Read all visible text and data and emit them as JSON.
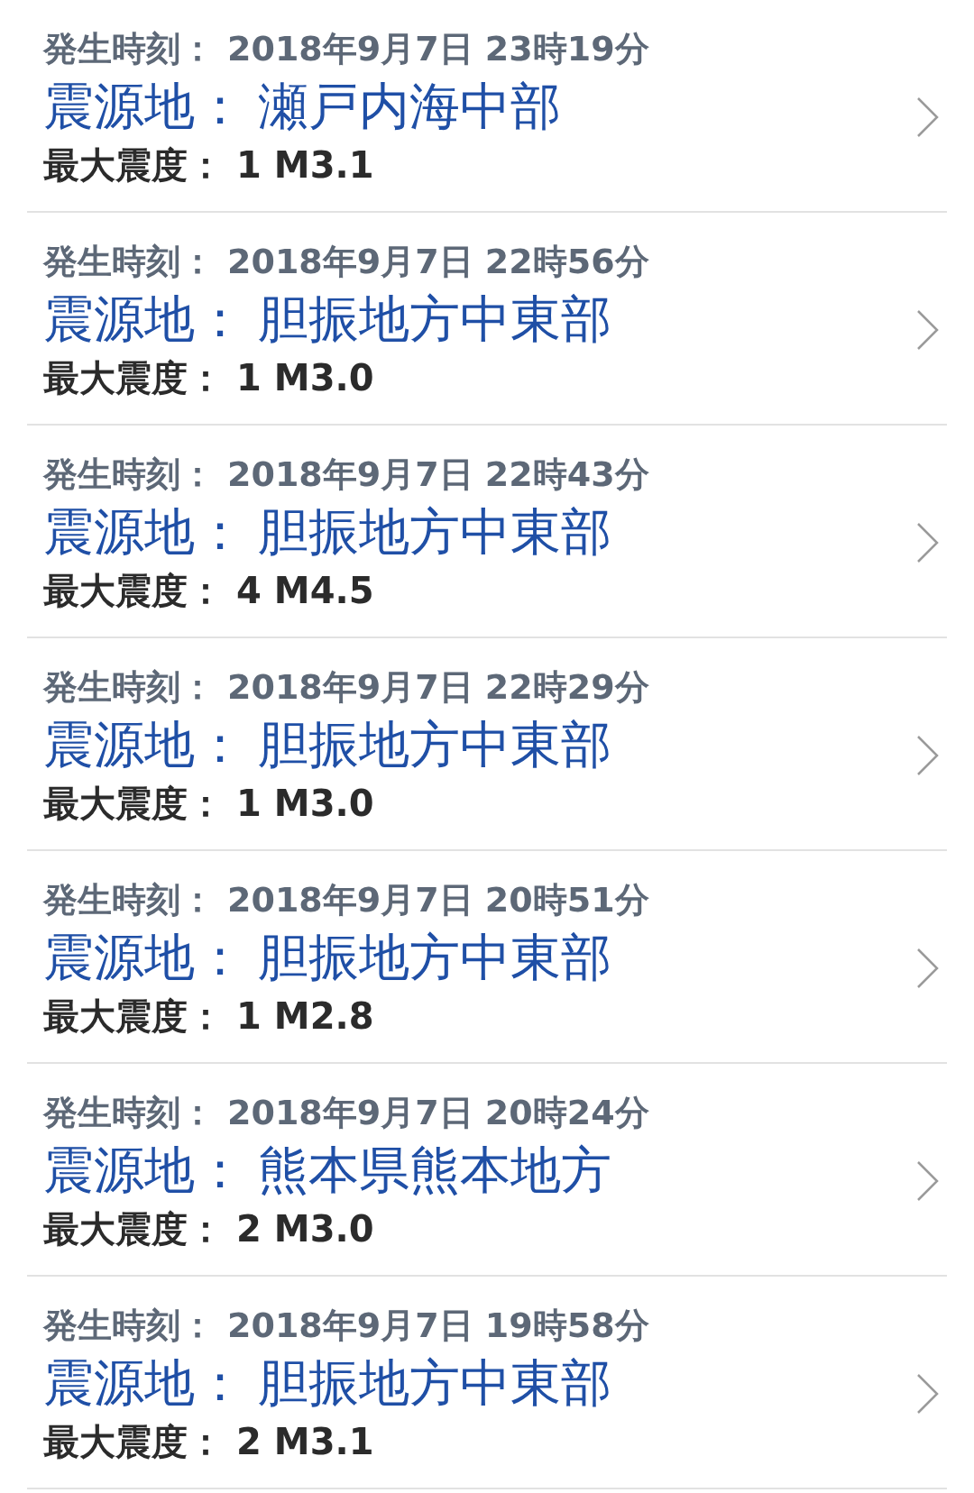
{
  "earthquakes": [
    {
      "time_label": "発生時刻：",
      "time": "2018年9月7日 23時19分",
      "epicenter_label": "震源地：",
      "epicenter": "瀬戸内海中部",
      "intensity_label": "最大震度：",
      "intensity": "1",
      "magnitude": "M3.1"
    },
    {
      "time_label": "発生時刻：",
      "time": "2018年9月7日 22時56分",
      "epicenter_label": "震源地：",
      "epicenter": "胆振地方中東部",
      "intensity_label": "最大震度：",
      "intensity": "1",
      "magnitude": "M3.0"
    },
    {
      "time_label": "発生時刻：",
      "time": "2018年9月7日 22時43分",
      "epicenter_label": "震源地：",
      "epicenter": "胆振地方中東部",
      "intensity_label": "最大震度：",
      "intensity": "4",
      "magnitude": "M4.5"
    },
    {
      "time_label": "発生時刻：",
      "time": "2018年9月7日 22時29分",
      "epicenter_label": "震源地：",
      "epicenter": "胆振地方中東部",
      "intensity_label": "最大震度：",
      "intensity": "1",
      "magnitude": "M3.0"
    },
    {
      "time_label": "発生時刻：",
      "time": "2018年9月7日 20時51分",
      "epicenter_label": "震源地：",
      "epicenter": "胆振地方中東部",
      "intensity_label": "最大震度：",
      "intensity": "1",
      "magnitude": "M2.8"
    },
    {
      "time_label": "発生時刻：",
      "time": "2018年9月7日 20時24分",
      "epicenter_label": "震源地：",
      "epicenter": "熊本県熊本地方",
      "intensity_label": "最大震度：",
      "intensity": "2",
      "magnitude": "M3.0"
    },
    {
      "time_label": "発生時刻：",
      "time": "2018年9月7日 19時58分",
      "epicenter_label": "震源地：",
      "epicenter": "胆振地方中東部",
      "intensity_label": "最大震度：",
      "intensity": "2",
      "magnitude": "M3.1"
    }
  ]
}
